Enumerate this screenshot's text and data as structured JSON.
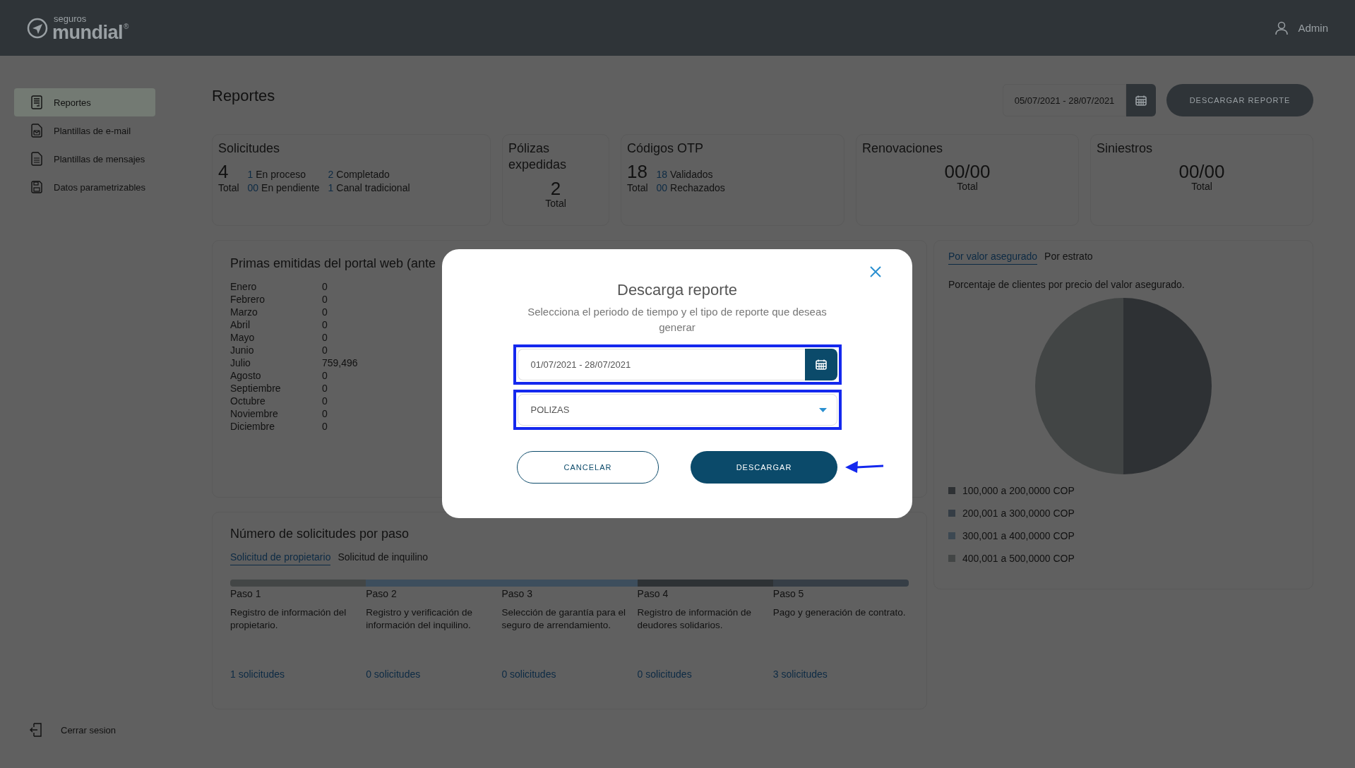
{
  "header": {
    "logo": {
      "tagline": "seguros",
      "wordmark": "mundial",
      "mark": "®"
    },
    "user": "Admin"
  },
  "sidebar": {
    "items": [
      {
        "label": "Reportes",
        "kind": "report",
        "selected": true
      },
      {
        "label": "Plantillas de e-mail",
        "kind": "email",
        "selected": false
      },
      {
        "label": "Plantillas de mensajes",
        "kind": "message",
        "selected": false
      },
      {
        "label": "Datos parametrizables",
        "kind": "data",
        "selected": false
      }
    ],
    "logout": "Cerrar sesion"
  },
  "page": {
    "title": "Reportes",
    "date_range": "05/07/2021 - 28/07/2021",
    "download_button": "DESCARGAR REPORTE"
  },
  "cards": [
    {
      "kind": "breakdown",
      "title": "Solicitudes",
      "value": "4",
      "value_label": "Total",
      "stats": [
        {
          "count": "1",
          "label": "En proceso"
        },
        {
          "count": "2",
          "label": "Completado"
        },
        {
          "count": "00",
          "label": "En pendiente"
        },
        {
          "count": "1",
          "label": "Canal tradicional"
        }
      ]
    },
    {
      "kind": "single",
      "title": "Pólizas expedidas",
      "value": "2",
      "value_label": "Total"
    },
    {
      "kind": "breakdown",
      "title": "Códigos OTP",
      "value": "18",
      "value_label": "Total",
      "stats": [
        {
          "count": "18",
          "label": "Validados"
        },
        {
          "count": "00",
          "label": "Rechazados"
        }
      ]
    },
    {
      "kind": "single",
      "title": "Renovaciones",
      "value": "00/00",
      "value_label": "Total"
    },
    {
      "kind": "single",
      "title": "Siniestros",
      "value": "00/00",
      "value_label": "Total"
    }
  ],
  "premiums": {
    "title": "Primas emitidas del portal web (ante",
    "rows": [
      {
        "month": "Enero",
        "value": "0"
      },
      {
        "month": "Febrero",
        "value": "0"
      },
      {
        "month": "Marzo",
        "value": "0"
      },
      {
        "month": "Abril",
        "value": "0"
      },
      {
        "month": "Mayo",
        "value": "0"
      },
      {
        "month": "Junio",
        "value": "0"
      },
      {
        "month": "Julio",
        "value": "759,496"
      },
      {
        "month": "Agosto",
        "value": "0"
      },
      {
        "month": "Septiembre",
        "value": "0"
      },
      {
        "month": "Octubre",
        "value": "0"
      },
      {
        "month": "Noviembre",
        "value": "0"
      },
      {
        "month": "Diciembre",
        "value": "0"
      }
    ]
  },
  "distribution": {
    "tabs": [
      {
        "label": "Por valor asegurado",
        "selected": true
      },
      {
        "label": "Por estrato",
        "selected": false
      }
    ],
    "description": "Porcentaje de clientes por precio del valor asegurado.",
    "legend": [
      {
        "label": "100,000 a 200,0000 COP",
        "color": "#2e3134"
      },
      {
        "label": "200,001 a 300,0000 COP",
        "color": "#353d45"
      },
      {
        "label": "300,001 a 400,0000 COP",
        "color": "#3c4852"
      },
      {
        "label": "400,001 a 500,0000 COP",
        "color": "#424545"
      }
    ]
  },
  "steps_panel": {
    "title": "Número de solicitudes por paso",
    "tabs": [
      {
        "label": "Solicitud de propietario",
        "selected": true
      },
      {
        "label": "Solicitud de inquilino",
        "selected": false
      }
    ],
    "steps": [
      {
        "label": "Paso 1",
        "description": "Registro de información del propietario.",
        "count": "1 solicitudes",
        "color": "#434646"
      },
      {
        "label": "Paso 2",
        "description": "Registro y verificación de información del inquilino.",
        "count": "0 solicitudes",
        "color": "#3d4e5d"
      },
      {
        "label": "Paso 3",
        "description": "Selección de garantía para el seguro de arrendamiento.",
        "count": "0 solicitudes",
        "color": "#3d4e5d"
      },
      {
        "label": "Paso 4",
        "description": "Registro de información de deudores solidarios.",
        "count": "0 solicitudes",
        "color": "#2e3235"
      },
      {
        "label": "Paso 5",
        "description": "Pago y generación de contrato.",
        "count": "3 solicitudes",
        "color": "#363e46"
      }
    ]
  },
  "modal": {
    "title": "Descarga reporte",
    "subtitle": "Selecciona el periodo de tiempo y el tipo de reporte que deseas generar",
    "date_field": {
      "value": "01/07/2021 - 28/07/2021",
      "highlighted": true
    },
    "type_select": {
      "value": "POLIZAS",
      "highlighted": true
    },
    "cancel_button": "CANCELAR",
    "download_button": {
      "label": "DESCARGAR",
      "annotated": true
    }
  }
}
